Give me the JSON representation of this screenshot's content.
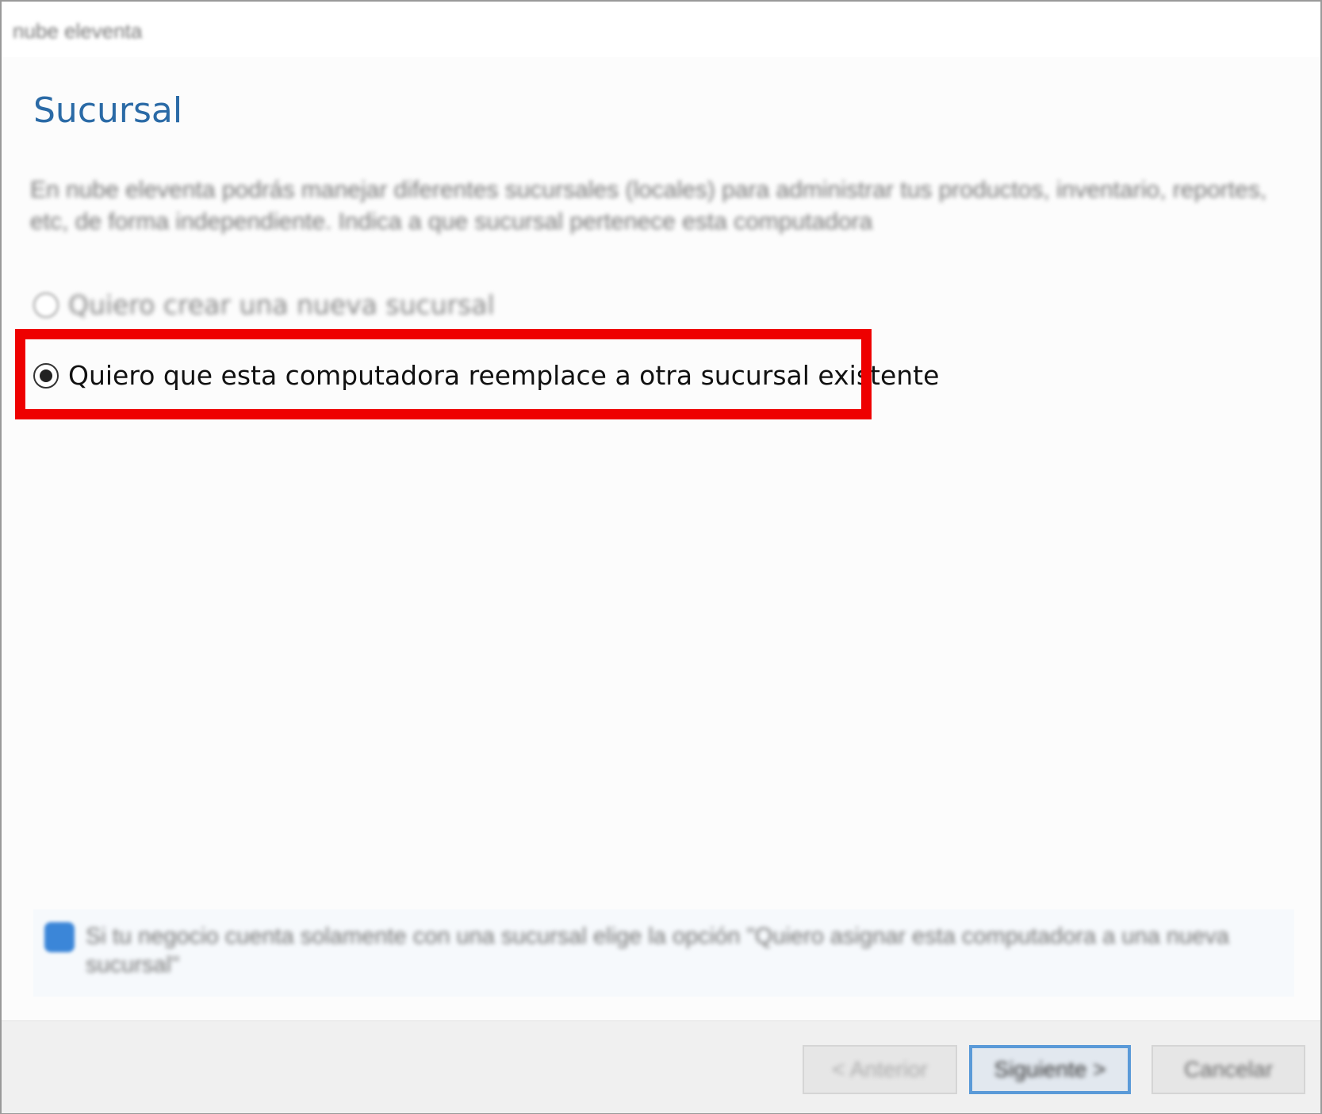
{
  "window": {
    "title": "nube eleventa"
  },
  "page": {
    "title": "Sucursal",
    "description": "En nube eleventa podrás manejar diferentes sucursales (locales) para administrar tus productos, inventario, reportes, etc, de forma independiente. Indica a que sucursal pertenece esta computadora"
  },
  "options": [
    {
      "label": "Quiero crear una nueva sucursal",
      "selected": false
    },
    {
      "label": "Quiero que esta computadora reemplace a otra sucursal existente",
      "selected": true
    }
  ],
  "info": {
    "icon": "info-icon",
    "text": "Si tu negocio cuenta solamente con una sucursal elige la opción \"Quiero asignar esta computadora a una nueva sucursal\""
  },
  "buttons": {
    "back": "< Anterior",
    "next": "Siguiente >",
    "cancel": "Cancelar"
  },
  "colors": {
    "highlight": "#ee0000",
    "title": "#2a6aa6",
    "info_icon": "#3b86d8"
  }
}
